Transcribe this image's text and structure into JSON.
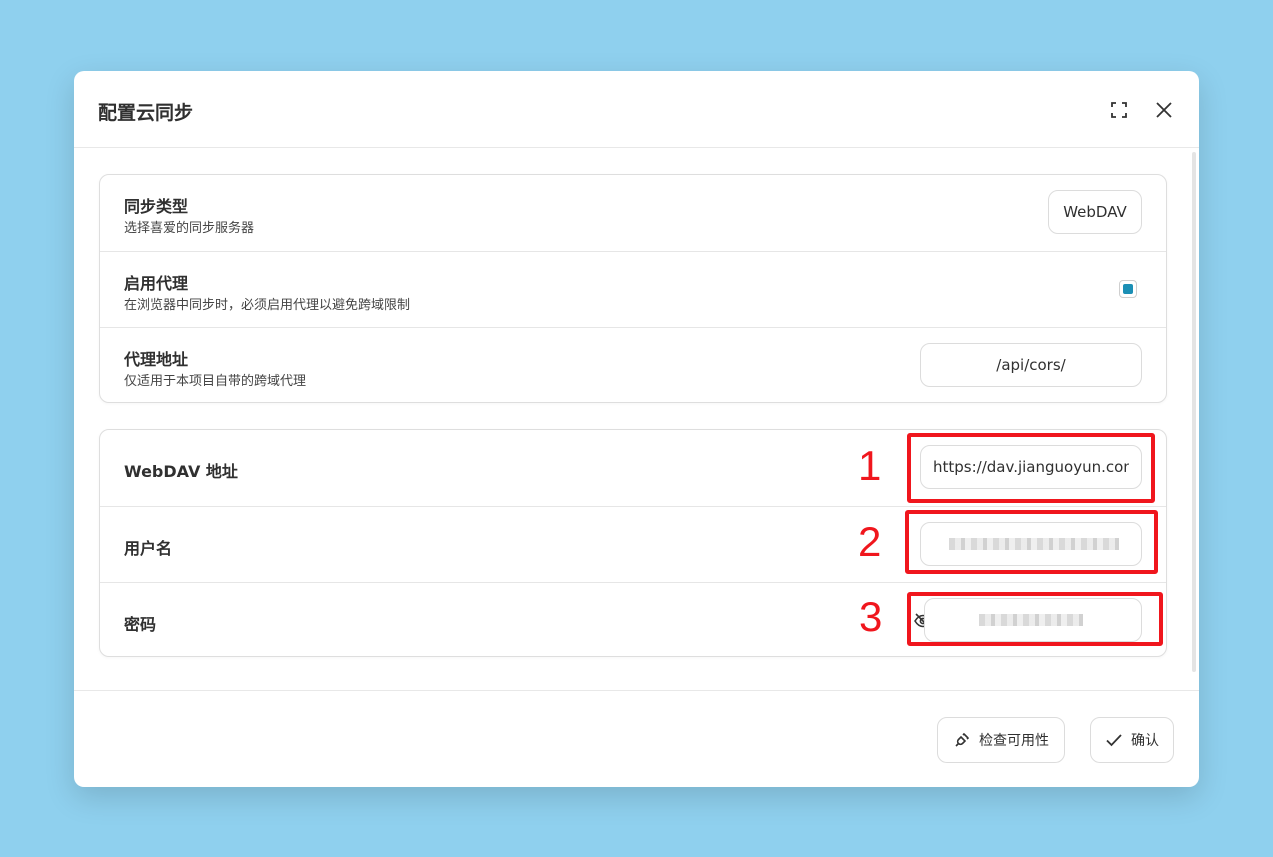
{
  "dialog": {
    "title": "配置云同步",
    "maximize_icon": "maximize-icon",
    "close_icon": "close-icon"
  },
  "sync_settings": {
    "sync_type": {
      "title": "同步类型",
      "description": "选择喜爱的同步服务器",
      "value": "WebDAV"
    },
    "proxy": {
      "title": "启用代理",
      "description": "在浏览器中同步时，必须启用代理以避免跨域限制",
      "checked": true
    },
    "proxy_url": {
      "title": "代理地址",
      "description": "仅适用于本项目自带的跨域代理",
      "value": "/api/cors/"
    }
  },
  "webdav": {
    "endpoint": {
      "label": "WebDAV 地址",
      "value": "https://dav.jianguoyun.com/dav/"
    },
    "username": {
      "label": "用户名",
      "value": ""
    },
    "password": {
      "label": "密码",
      "value": "",
      "toggle_icon": "eye-off-icon"
    }
  },
  "annotations": [
    "1",
    "2",
    "3"
  ],
  "annotation_color": "#f0161d",
  "accent_color": "#1b8fb5",
  "footer": {
    "check_label": "检查可用性",
    "check_icon": "plug-icon",
    "confirm_label": "确认",
    "confirm_icon": "check-icon"
  }
}
